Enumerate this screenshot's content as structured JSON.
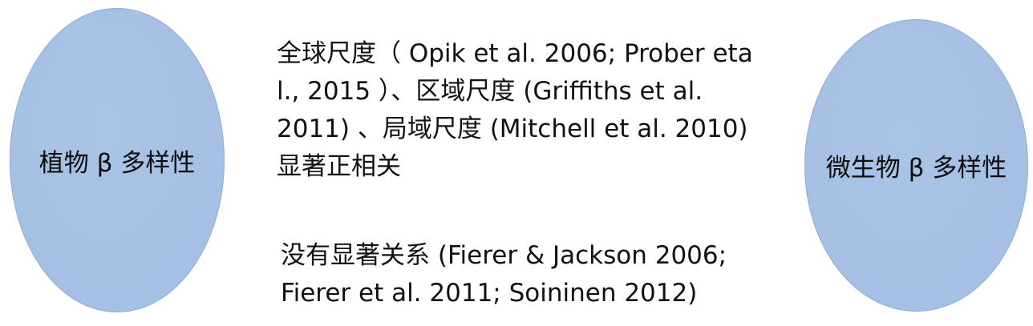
{
  "colors": {
    "ellipse_fill": "#a9c4e6",
    "ellipse_fill_edge": "#a3bee3",
    "text": "#111111"
  },
  "left_node": {
    "label": "植物 β 多样性"
  },
  "right_node": {
    "label": "微生物 β 多样性"
  },
  "positive_relation": {
    "lines": [
      "全球尺度（  Opik et al. 2006; Prober eta",
      "l., 2015 ）、区域尺度 (Griffiths et al.",
      "2011) 、局域尺度 (Mitchell et al. 2010)",
      "显著正相关"
    ]
  },
  "no_relation": {
    "lines": [
      "没有显著关系 (Fierer & Jackson 2006;",
      "Fierer et al. 2011; Soininen 2012)"
    ]
  }
}
